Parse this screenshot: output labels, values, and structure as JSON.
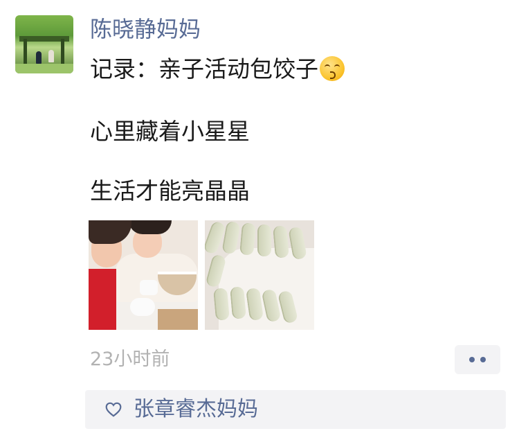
{
  "post": {
    "author": "陈晓静妈妈",
    "lines": [
      "记录：亲子活动包饺子",
      "心里藏着小星星",
      "生活才能亮晶晶"
    ],
    "emoji_icon": "kissing-face-icon",
    "time": "23小时前"
  },
  "likes": {
    "icon": "heart-outline-icon",
    "names": "张章睿杰妈妈"
  },
  "colors": {
    "name_link": "#586b95",
    "body_text": "#1a1a1a",
    "timestamp": "#b2b2b2",
    "panel_bg": "#f3f3f5"
  }
}
